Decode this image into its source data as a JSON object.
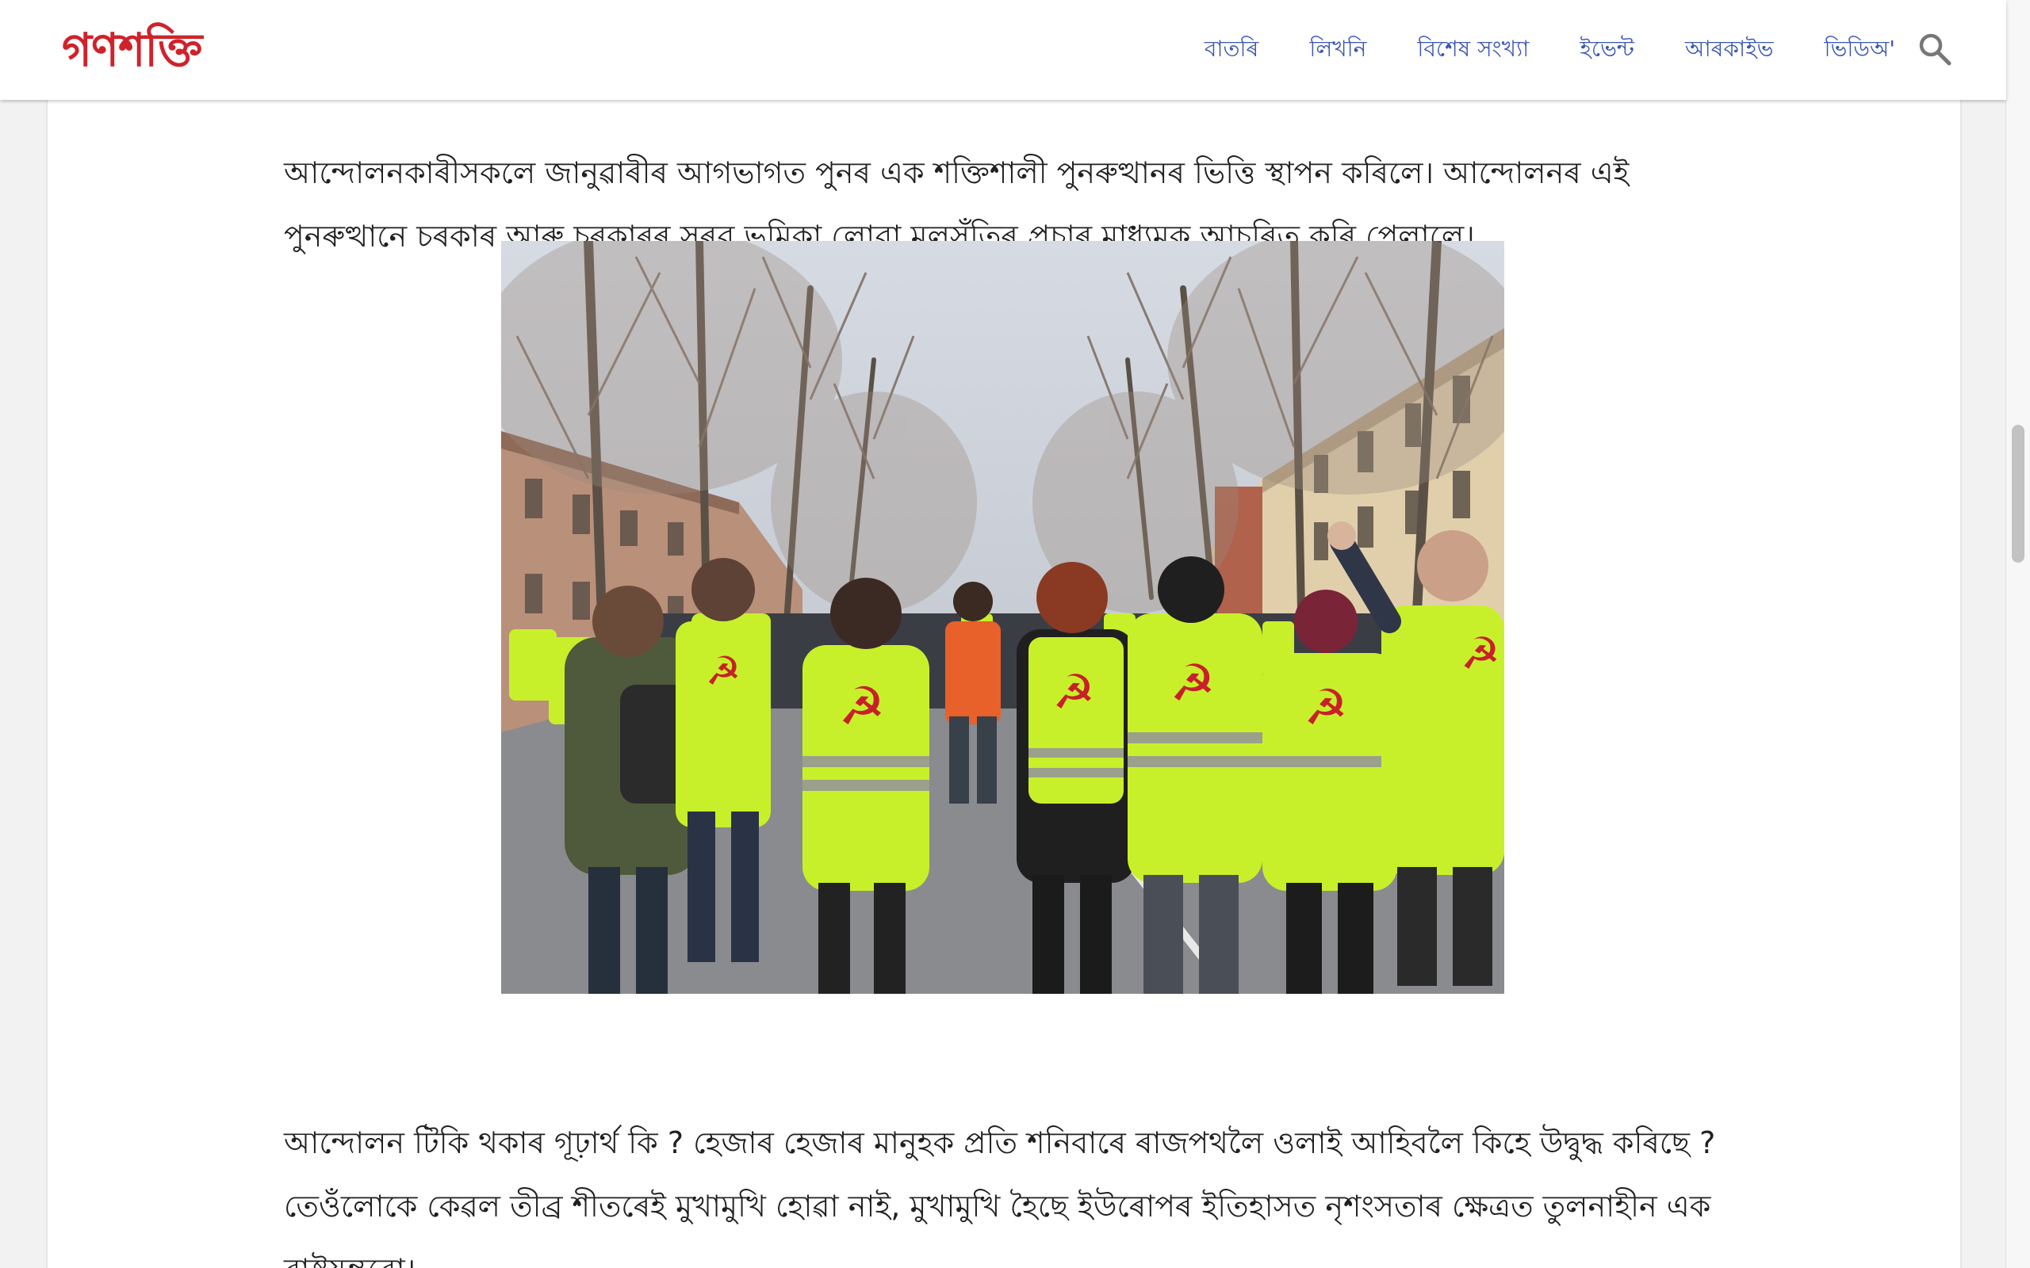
{
  "header": {
    "logo": "গণশক্তি",
    "nav": [
      "বাতৰি",
      "লিখনি",
      "বিশেষ সংখ্যা",
      "ইভেন্ট",
      "আৰকাইভ",
      "ভিডিঅ'"
    ]
  },
  "article": {
    "paragraph_1": "আন্দোলনকাৰীসকলে জানুৱাৰীৰ আগভাগত পুনৰ এক শক্তিশালী পুনৰুত্থানৰ ভিত্তি স্থাপন কৰিলে। আন্দোলনৰ এই পুনৰুত্থানে চৰকাৰ আৰু চৰকাৰৰ সৰৱ ভূমিকা লোৱা মূলসুঁতিৰ প্ৰচাৰ মাধ্যমক আচৰিত কৰি পেলালে।",
    "paragraph_2": "আন্দোলন টিকি থকাৰ গূঢ়াৰ্থ কি ? হেজাৰ হেজাৰ মানুহক প্ৰতি শনিবাৰে ৰাজপথলৈ ওলাই আহিবলৈ কিহে উদ্বুদ্ধ কৰিছে ? তেওঁলোকে কেৱল তীব্ৰ শীতৰেই মুখামুখি হোৱা নাই, মুখামুখি হৈছে ইউৰোপৰ ইতিহাসত নৃশংসতাৰ ক্ষেত্ৰত তুলনাহীন এক ৰাষ্ট্ৰযন্ত্ৰৰো।"
  },
  "colors": {
    "brand": "#d0222b",
    "nav_link": "#3b55b4",
    "vest": "#c8f02a"
  }
}
